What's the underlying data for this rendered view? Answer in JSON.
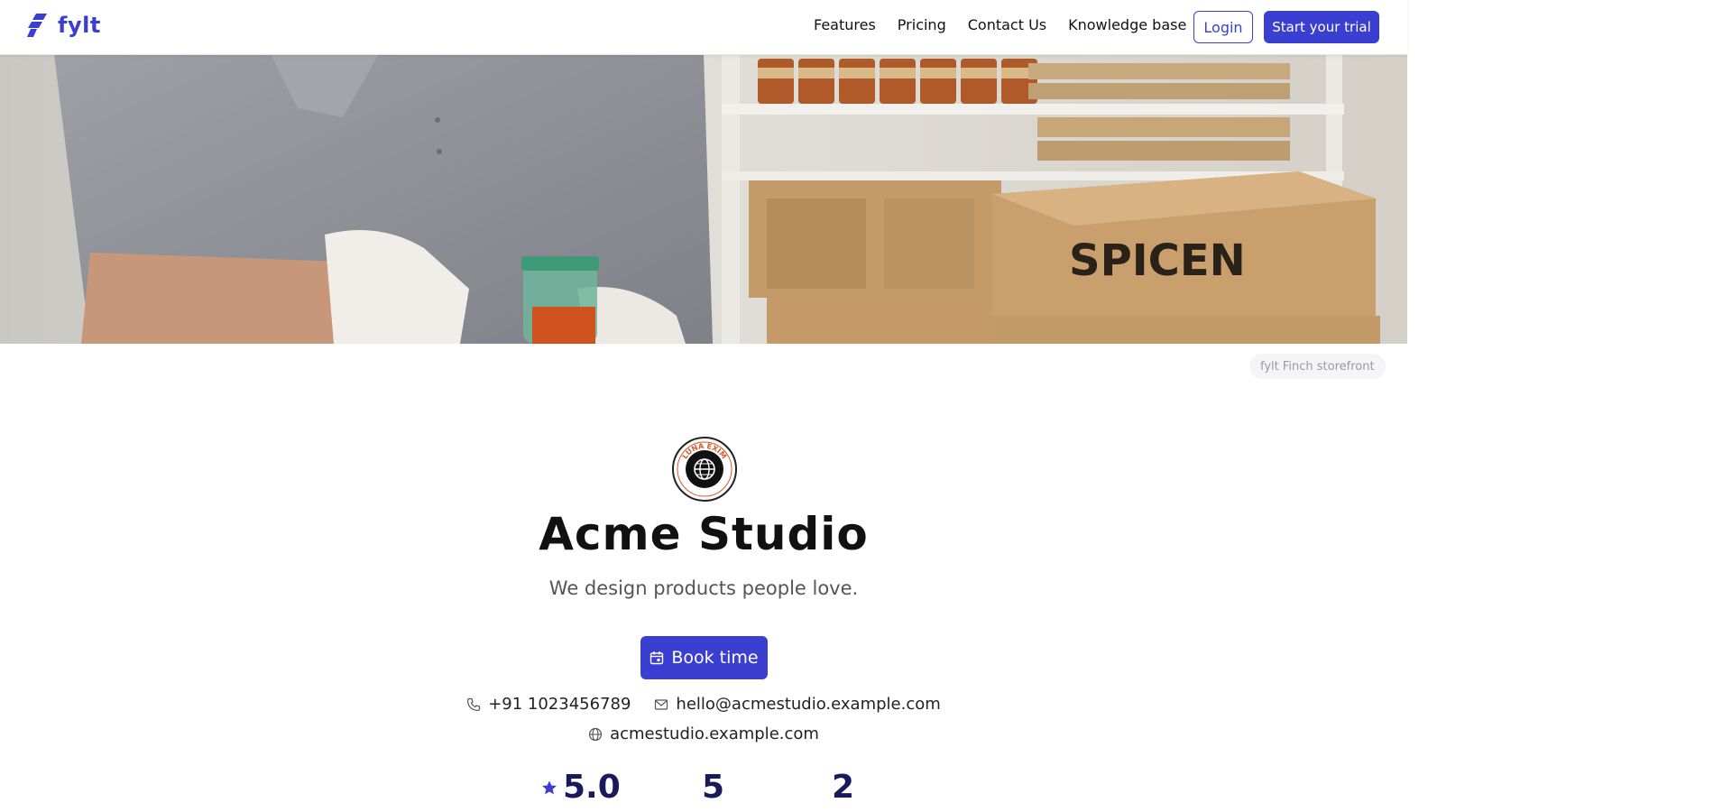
{
  "brand": {
    "name": "fylt",
    "color": "#3a3fd1"
  },
  "nav": {
    "items": [
      "Features",
      "Pricing",
      "Contact Us",
      "Knowledge base"
    ],
    "login_label": "Login",
    "trial_label": "Start your trial"
  },
  "hero": {
    "storefront_badge": "fylt Finch storefront",
    "box_label": "SPICEN"
  },
  "profile": {
    "logo_text": "LUNA EXIM",
    "name": "Acme Studio",
    "tagline": "We design products people love.",
    "book_label": "Book time"
  },
  "contact": {
    "phone": "+91 1023456789",
    "email": "hello@acmestudio.example.com",
    "website": "acmestudio.example.com"
  },
  "stats": {
    "rating": "5.0",
    "second": "5",
    "third": "2"
  },
  "icons": {
    "phone": "phone-icon",
    "email": "mail-icon",
    "website": "globe-icon",
    "book": "calendar-icon",
    "rating": "star-icon"
  }
}
